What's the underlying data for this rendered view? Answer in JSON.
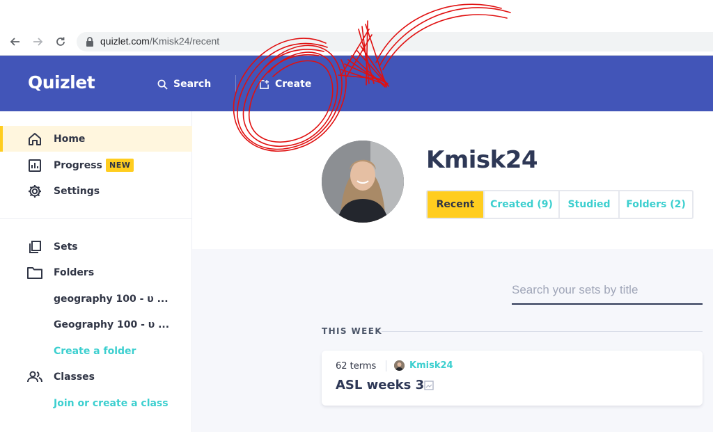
{
  "browser": {
    "url_host": "quizlet.com",
    "url_path": "/Kmisk24/recent"
  },
  "header": {
    "logo": "Quizlet",
    "search_label": "Search",
    "create_label": "Create",
    "bg_color": "#4255b8"
  },
  "sidebar": {
    "items": [
      {
        "label": "Home",
        "icon": "home-icon",
        "active": true
      },
      {
        "label": "Progress",
        "icon": "progress-chart-icon",
        "badge": "NEW"
      },
      {
        "label": "Settings",
        "icon": "gear-icon"
      },
      {
        "label": "Sets",
        "icon": "sets-icon"
      },
      {
        "label": "Folders",
        "icon": "folder-icon"
      },
      {
        "label": "geography 100 - υ ..."
      },
      {
        "label": "Geography 100 - υ ..."
      },
      {
        "label": "Create a folder"
      },
      {
        "label": "Classes",
        "icon": "people-icon"
      },
      {
        "label": "Join or create a class"
      }
    ]
  },
  "profile": {
    "username": "Kmisk24",
    "tabs": [
      {
        "label": "Recent",
        "active": true
      },
      {
        "label": "Created (9)"
      },
      {
        "label": "Studied"
      },
      {
        "label": "Folders (2)"
      }
    ]
  },
  "search": {
    "placeholder": "Search your sets by title"
  },
  "section": {
    "label": "THIS WEEK"
  },
  "sets": [
    {
      "term_count": "62 terms",
      "creator": "Kmisk24",
      "title": "ASL weeks 3"
    }
  ],
  "colors": {
    "accent_yellow": "#ffcd1f",
    "link_teal": "#3ccfcf",
    "text_dark": "#2e3856",
    "annotation_red": "#e01010"
  }
}
